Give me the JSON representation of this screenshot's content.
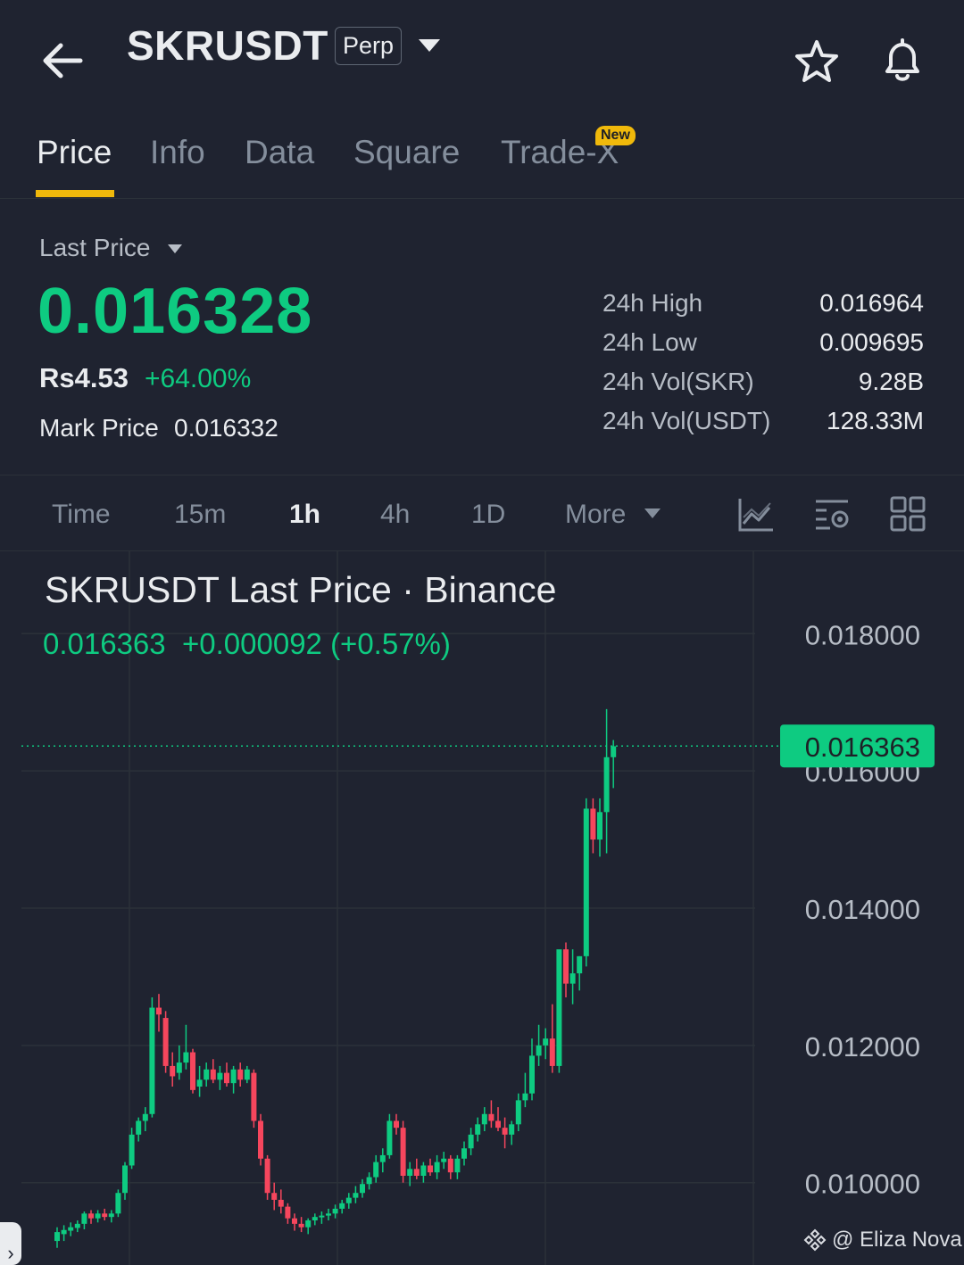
{
  "header": {
    "symbol": "SKRUSDT",
    "badge": "Perp"
  },
  "tabs": [
    {
      "label": "Price",
      "active": true
    },
    {
      "label": "Info"
    },
    {
      "label": "Data"
    },
    {
      "label": "Square"
    },
    {
      "label": "Trade-X",
      "badge": "New"
    }
  ],
  "price": {
    "label": "Last Price",
    "value": "0.016328",
    "fiat": "Rs4.53",
    "change_pct": "+64.00%",
    "mark_label": "Mark Price",
    "mark_value": "0.016332"
  },
  "stats": [
    {
      "label": "24h High",
      "value": "0.016964"
    },
    {
      "label": "24h Low",
      "value": "0.009695"
    },
    {
      "label": "24h Vol(SKR)",
      "value": "9.28B"
    },
    {
      "label": "24h Vol(USDT)",
      "value": "128.33M"
    }
  ],
  "intervals": [
    "Time",
    "15m",
    "1h",
    "4h",
    "1D",
    "More"
  ],
  "active_interval": "1h",
  "chart_header": {
    "title": "SKRUSDT Last Price · Binance",
    "current": "0.016363",
    "change": "+0.000092 (+0.57%)"
  },
  "watermark": "@ Eliza Nova",
  "colors": {
    "up": "#0ecb81",
    "down": "#f6465d",
    "accent": "#f0b90b",
    "background": "#1f2330"
  },
  "chart_data": {
    "type": "candlestick",
    "ylim": [
      0.0088,
      0.0192
    ],
    "y_ticks": [
      0.01,
      0.012,
      0.014,
      0.016,
      0.018
    ],
    "y_tick_labels": [
      "0.010000",
      "0.012000",
      "0.014000",
      "0.016000",
      "0.018000"
    ],
    "current_price": 0.016363,
    "current_price_label": "0.016363",
    "candles": [
      {
        "o": 0.00915,
        "h": 0.00935,
        "l": 0.00905,
        "c": 0.00928
      },
      {
        "o": 0.00925,
        "h": 0.00938,
        "l": 0.00915,
        "c": 0.00931
      },
      {
        "o": 0.0093,
        "h": 0.00942,
        "l": 0.00922,
        "c": 0.00935
      },
      {
        "o": 0.00934,
        "h": 0.00945,
        "l": 0.00928,
        "c": 0.0094
      },
      {
        "o": 0.0094,
        "h": 0.00958,
        "l": 0.00932,
        "c": 0.00955
      },
      {
        "o": 0.00955,
        "h": 0.0096,
        "l": 0.0094,
        "c": 0.00948
      },
      {
        "o": 0.00948,
        "h": 0.0096,
        "l": 0.00942,
        "c": 0.00955
      },
      {
        "o": 0.00955,
        "h": 0.00962,
        "l": 0.00945,
        "c": 0.0095
      },
      {
        "o": 0.0095,
        "h": 0.0096,
        "l": 0.00942,
        "c": 0.00955
      },
      {
        "o": 0.00955,
        "h": 0.0099,
        "l": 0.0095,
        "c": 0.00985
      },
      {
        "o": 0.00985,
        "h": 0.0103,
        "l": 0.00975,
        "c": 0.01025
      },
      {
        "o": 0.01025,
        "h": 0.0108,
        "l": 0.0102,
        "c": 0.0107
      },
      {
        "o": 0.0107,
        "h": 0.01095,
        "l": 0.0106,
        "c": 0.0109
      },
      {
        "o": 0.0109,
        "h": 0.0111,
        "l": 0.01075,
        "c": 0.011
      },
      {
        "o": 0.011,
        "h": 0.0127,
        "l": 0.01095,
        "c": 0.01255
      },
      {
        "o": 0.01255,
        "h": 0.01275,
        "l": 0.0122,
        "c": 0.01245
      },
      {
        "o": 0.0124,
        "h": 0.0125,
        "l": 0.0116,
        "c": 0.0117
      },
      {
        "o": 0.0117,
        "h": 0.0119,
        "l": 0.0114,
        "c": 0.01155
      },
      {
        "o": 0.0116,
        "h": 0.012,
        "l": 0.0115,
        "c": 0.01175
      },
      {
        "o": 0.01175,
        "h": 0.0123,
        "l": 0.01165,
        "c": 0.0119
      },
      {
        "o": 0.0119,
        "h": 0.01195,
        "l": 0.0113,
        "c": 0.01135
      },
      {
        "o": 0.0114,
        "h": 0.0117,
        "l": 0.01125,
        "c": 0.0115
      },
      {
        "o": 0.0115,
        "h": 0.01175,
        "l": 0.0114,
        "c": 0.01165
      },
      {
        "o": 0.01165,
        "h": 0.0118,
        "l": 0.01145,
        "c": 0.0115
      },
      {
        "o": 0.0115,
        "h": 0.0117,
        "l": 0.01135,
        "c": 0.0116
      },
      {
        "o": 0.0116,
        "h": 0.01175,
        "l": 0.0114,
        "c": 0.01145
      },
      {
        "o": 0.01145,
        "h": 0.0117,
        "l": 0.0113,
        "c": 0.01165
      },
      {
        "o": 0.01165,
        "h": 0.01175,
        "l": 0.0114,
        "c": 0.0115
      },
      {
        "o": 0.0115,
        "h": 0.0117,
        "l": 0.01145,
        "c": 0.01165
      },
      {
        "o": 0.0116,
        "h": 0.01165,
        "l": 0.0108,
        "c": 0.0109
      },
      {
        "o": 0.0109,
        "h": 0.011,
        "l": 0.01025,
        "c": 0.01035
      },
      {
        "o": 0.01035,
        "h": 0.0104,
        "l": 0.00975,
        "c": 0.00985
      },
      {
        "o": 0.00985,
        "h": 0.01,
        "l": 0.0096,
        "c": 0.00975
      },
      {
        "o": 0.00975,
        "h": 0.0099,
        "l": 0.00955,
        "c": 0.00965
      },
      {
        "o": 0.00965,
        "h": 0.0097,
        "l": 0.0094,
        "c": 0.00948
      },
      {
        "o": 0.00948,
        "h": 0.00955,
        "l": 0.0093,
        "c": 0.0094
      },
      {
        "o": 0.0094,
        "h": 0.0095,
        "l": 0.00928,
        "c": 0.00935
      },
      {
        "o": 0.00935,
        "h": 0.00948,
        "l": 0.00925,
        "c": 0.00945
      },
      {
        "o": 0.00945,
        "h": 0.00955,
        "l": 0.00938,
        "c": 0.0095
      },
      {
        "o": 0.0095,
        "h": 0.00958,
        "l": 0.0094,
        "c": 0.00952
      },
      {
        "o": 0.00952,
        "h": 0.00962,
        "l": 0.00945,
        "c": 0.00955
      },
      {
        "o": 0.00955,
        "h": 0.00968,
        "l": 0.00948,
        "c": 0.00962
      },
      {
        "o": 0.00962,
        "h": 0.00975,
        "l": 0.00955,
        "c": 0.0097
      },
      {
        "o": 0.0097,
        "h": 0.00985,
        "l": 0.00962,
        "c": 0.00978
      },
      {
        "o": 0.00978,
        "h": 0.00995,
        "l": 0.0097,
        "c": 0.00985
      },
      {
        "o": 0.00985,
        "h": 0.01005,
        "l": 0.00978,
        "c": 0.00998
      },
      {
        "o": 0.00998,
        "h": 0.01015,
        "l": 0.0099,
        "c": 0.01008
      },
      {
        "o": 0.01008,
        "h": 0.0104,
        "l": 0.01,
        "c": 0.0103
      },
      {
        "o": 0.0103,
        "h": 0.0105,
        "l": 0.01015,
        "c": 0.0104
      },
      {
        "o": 0.0104,
        "h": 0.011,
        "l": 0.01035,
        "c": 0.0109
      },
      {
        "o": 0.0109,
        "h": 0.011,
        "l": 0.0107,
        "c": 0.0108
      },
      {
        "o": 0.0108,
        "h": 0.0109,
        "l": 0.01,
        "c": 0.0101
      },
      {
        "o": 0.0101,
        "h": 0.0103,
        "l": 0.00995,
        "c": 0.0102
      },
      {
        "o": 0.0102,
        "h": 0.01035,
        "l": 0.01005,
        "c": 0.0101
      },
      {
        "o": 0.0101,
        "h": 0.0103,
        "l": 0.01,
        "c": 0.01025
      },
      {
        "o": 0.01025,
        "h": 0.01035,
        "l": 0.0101,
        "c": 0.01015
      },
      {
        "o": 0.01015,
        "h": 0.0104,
        "l": 0.01005,
        "c": 0.0103
      },
      {
        "o": 0.0103,
        "h": 0.01045,
        "l": 0.0102,
        "c": 0.01035
      },
      {
        "o": 0.01035,
        "h": 0.0104,
        "l": 0.01005,
        "c": 0.01015
      },
      {
        "o": 0.01015,
        "h": 0.0104,
        "l": 0.01005,
        "c": 0.01035
      },
      {
        "o": 0.01035,
        "h": 0.0106,
        "l": 0.01025,
        "c": 0.0105
      },
      {
        "o": 0.0105,
        "h": 0.0108,
        "l": 0.0104,
        "c": 0.0107
      },
      {
        "o": 0.0107,
        "h": 0.01095,
        "l": 0.0106,
        "c": 0.01085
      },
      {
        "o": 0.01085,
        "h": 0.0111,
        "l": 0.01075,
        "c": 0.011
      },
      {
        "o": 0.011,
        "h": 0.0112,
        "l": 0.0108,
        "c": 0.0109
      },
      {
        "o": 0.0109,
        "h": 0.0111,
        "l": 0.01075,
        "c": 0.0108
      },
      {
        "o": 0.0108,
        "h": 0.01095,
        "l": 0.0105,
        "c": 0.0107
      },
      {
        "o": 0.0107,
        "h": 0.0109,
        "l": 0.01055,
        "c": 0.01085
      },
      {
        "o": 0.01085,
        "h": 0.0113,
        "l": 0.01075,
        "c": 0.0112
      },
      {
        "o": 0.0112,
        "h": 0.0116,
        "l": 0.0111,
        "c": 0.0113
      },
      {
        "o": 0.0113,
        "h": 0.0121,
        "l": 0.0112,
        "c": 0.01185
      },
      {
        "o": 0.01185,
        "h": 0.0123,
        "l": 0.0117,
        "c": 0.012
      },
      {
        "o": 0.012,
        "h": 0.01225,
        "l": 0.0118,
        "c": 0.0121
      },
      {
        "o": 0.0121,
        "h": 0.0126,
        "l": 0.0116,
        "c": 0.0117
      },
      {
        "o": 0.0117,
        "h": 0.0132,
        "l": 0.0116,
        "c": 0.0134
      },
      {
        "o": 0.0134,
        "h": 0.0135,
        "l": 0.0127,
        "c": 0.0129
      },
      {
        "o": 0.0129,
        "h": 0.0134,
        "l": 0.0126,
        "c": 0.01305
      },
      {
        "o": 0.01305,
        "h": 0.0133,
        "l": 0.0128,
        "c": 0.0133
      },
      {
        "o": 0.0133,
        "h": 0.0156,
        "l": 0.01315,
        "c": 0.01545
      },
      {
        "o": 0.01545,
        "h": 0.0156,
        "l": 0.0148,
        "c": 0.015
      },
      {
        "o": 0.015,
        "h": 0.0156,
        "l": 0.01475,
        "c": 0.0154
      },
      {
        "o": 0.0154,
        "h": 0.0169,
        "l": 0.0148,
        "c": 0.0162
      },
      {
        "o": 0.0162,
        "h": 0.01645,
        "l": 0.01575,
        "c": 0.01636
      }
    ]
  }
}
